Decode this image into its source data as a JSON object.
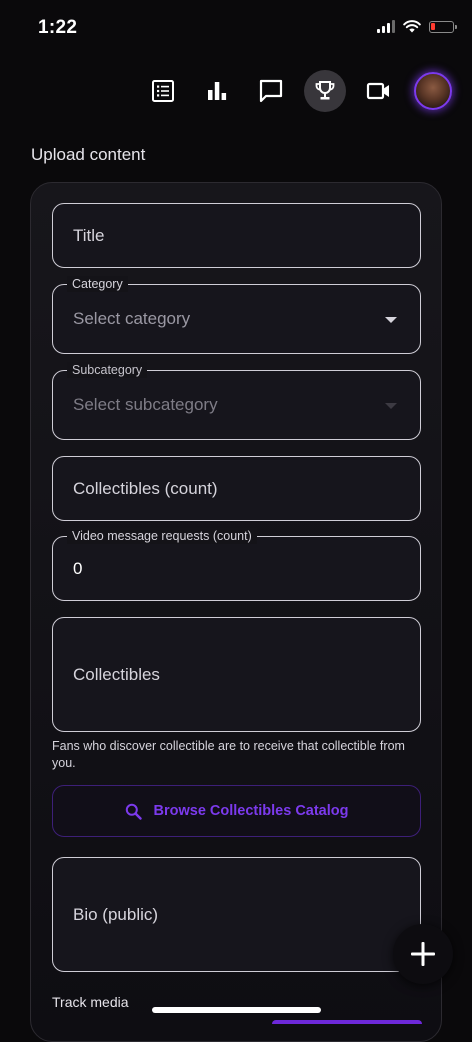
{
  "status_bar": {
    "time": "1:22"
  },
  "top_nav": {
    "items": [
      {
        "icon": "list-icon"
      },
      {
        "icon": "bar-chart-icon"
      },
      {
        "icon": "chat-icon"
      },
      {
        "icon": "trophy-icon",
        "active": true
      },
      {
        "icon": "video-camera-icon"
      },
      {
        "icon": "avatar"
      }
    ]
  },
  "page": {
    "title": "Upload content"
  },
  "form": {
    "title": {
      "placeholder": "Title"
    },
    "category": {
      "label": "Category",
      "placeholder": "Select category"
    },
    "subcategory": {
      "label": "Subcategory",
      "placeholder": "Select subcategory",
      "disabled": true
    },
    "collectibles_count": {
      "placeholder": "Collectibles (count)"
    },
    "video_requests": {
      "label": "Video message requests (count)",
      "value": "0"
    },
    "collectibles": {
      "placeholder": "Collectibles",
      "helper": "Fans who discover collectible are to receive that collectible from you."
    },
    "browse_button": {
      "label": "Browse Collectibles Catalog",
      "icon": "search-icon"
    },
    "bio": {
      "placeholder": "Bio (public)"
    },
    "track_media": {
      "label": "Track media"
    }
  },
  "fab": {
    "icon": "plus-icon"
  },
  "colors": {
    "accent": "#7c3aed",
    "background": "#0a090b",
    "field_border": "#cfcdd6"
  }
}
